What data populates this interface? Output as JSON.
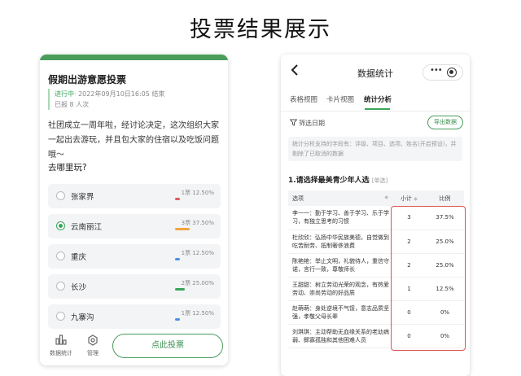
{
  "page_title": "投票结果展示",
  "left": {
    "title": "假期出游意愿投票",
    "status": "进行中",
    "time": "· 2022年09月10日16:05 结束",
    "count": "已报 8 人次",
    "description": "社团成立一周年啦，经讨论决定，这次组织大家一起出去游玩，并且包大家的住宿以及吃饭问题哦～",
    "question": "去哪里玩?",
    "options": [
      {
        "label": "张家界",
        "stat": "1票 12.50%",
        "ratio": 0.125,
        "color": "#e05b5b",
        "checked": false
      },
      {
        "label": "云南丽江",
        "stat": "3票 37.50%",
        "ratio": 0.375,
        "color": "#f0a640",
        "checked": true
      },
      {
        "label": "重庆",
        "stat": "1票 12.50%",
        "ratio": 0.125,
        "color": "#4a90e2",
        "checked": false
      },
      {
        "label": "长沙",
        "stat": "2票 25.00%",
        "ratio": 0.25,
        "color": "#3aa55a",
        "checked": false
      },
      {
        "label": "九寨沟",
        "stat": "1票 12.50%",
        "ratio": 0.125,
        "color": "#4a90e2",
        "checked": false
      }
    ],
    "footer": {
      "stats_label": "数据统计",
      "stats_icon": "bar-chart-icon",
      "manage_label": "管理",
      "manage_icon": "gear-icon",
      "vote_button": "点此投票"
    }
  },
  "right": {
    "nav_title": "数据统计",
    "tabs": [
      "表格视图",
      "卡片视图",
      "统计分析"
    ],
    "active_tab": "统计分析",
    "filter_label": "筛选日期",
    "export_button": "导出数据",
    "notice": "统计分析支持的字段有：评级、项目、选项、姓名(开启预设)，并剔除了已取消的数据",
    "question_title": "1.请选择最美青少年人选",
    "question_tag": "[单选]",
    "table": {
      "headers": [
        "选项",
        "小计",
        "比例"
      ],
      "rows": [
        {
          "option": "李一一：勤于学习、善于学习、乐于学习，有独立思考的习惯",
          "count": "3",
          "ratio": "37.5%"
        },
        {
          "option": "杜欣欣：弘扬中华民族美德，自觉做到吃苦耐劳、抵制奢侈浪费",
          "count": "2",
          "ratio": "25.0%"
        },
        {
          "option": "陈艳艳：举止文明，礼貌待人，重信守诺，言行一致，尊敬师长",
          "count": "2",
          "ratio": "25.0%"
        },
        {
          "option": "王甜甜：树立劳动光荣的观念，有热爱劳动、崇尚劳动的好品质",
          "count": "1",
          "ratio": "12.5%"
        },
        {
          "option": "赵萌萌：身处逆境不气馁，意志品质坚强，孝敬父母长辈",
          "count": "0",
          "ratio": "0%"
        },
        {
          "option": "刘琪琪：主动帮助无血缘关系的老幼病弱、鳏寡孤独和其他困难人员",
          "count": "0",
          "ratio": "0%"
        }
      ]
    }
  }
}
